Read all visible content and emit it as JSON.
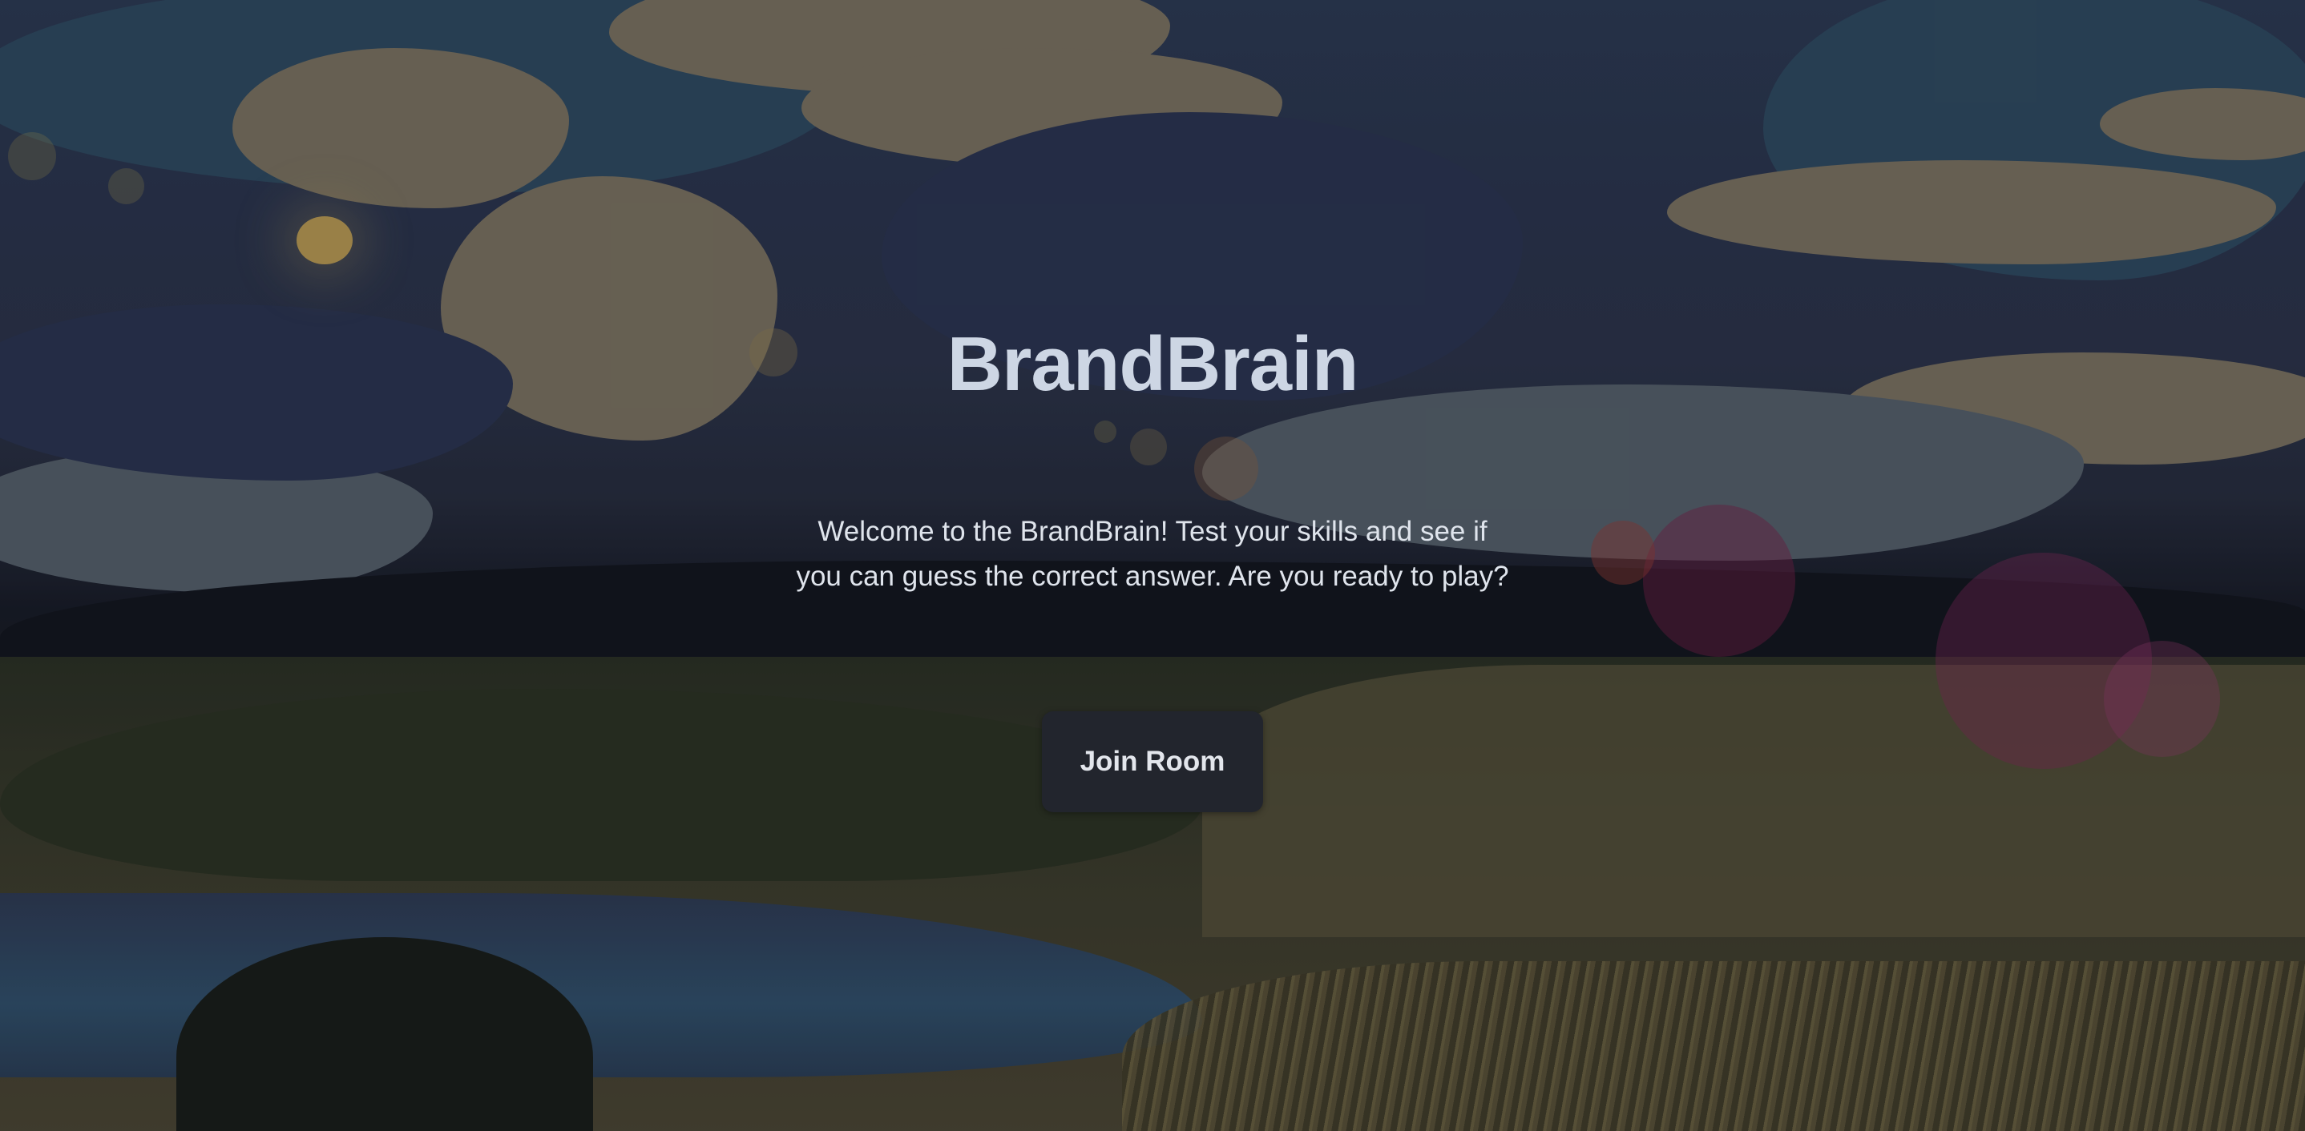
{
  "app": {
    "title": "BrandBrain"
  },
  "hero": {
    "title": "BrandBrain",
    "welcome_text": "Welcome to the BrandBrain! Test your skills and see if you can guess the correct answer. Are you ready to play?",
    "join_button_label": "Join Room"
  },
  "theme": {
    "title_color": "#cdd6e4",
    "text_color": "#dfe4ec",
    "button_bg": "#22252d",
    "button_text": "#e3e6ec"
  }
}
